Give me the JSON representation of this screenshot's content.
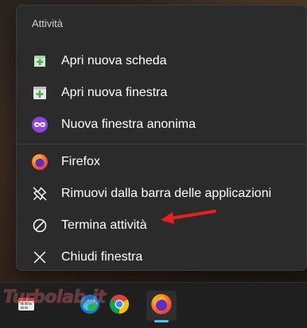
{
  "menu": {
    "header": "Attività",
    "items": [
      {
        "label": "Apri nuova scheda",
        "icon": "new-tab-icon"
      },
      {
        "label": "Apri nuova finestra",
        "icon": "new-window-icon"
      },
      {
        "label": "Nuova finestra anonima",
        "icon": "private-window-icon"
      },
      {
        "label": "Firefox",
        "icon": "firefox-icon"
      },
      {
        "label": "Rimuovi dalla barra delle applicazioni",
        "icon": "unpin-icon"
      },
      {
        "label": "Termina attività",
        "icon": "end-task-icon"
      },
      {
        "label": "Chiudi finestra",
        "icon": "close-icon"
      }
    ]
  },
  "annotation": {
    "arrow_color": "#e8201c",
    "points_to": "Termina attività"
  },
  "taskbar": {
    "apps": [
      {
        "name": "app-icon",
        "icon": "grid-app-icon"
      },
      {
        "name": "edge",
        "icon": "browser-icon"
      },
      {
        "name": "chrome",
        "icon": "chrome-icon"
      },
      {
        "name": "firefox",
        "icon": "firefox-icon",
        "active": true
      }
    ],
    "indicator_color": "#4cc2ff"
  },
  "watermark": "Turbolab.it",
  "colors": {
    "menu_bg": "#2b2b2b",
    "text": "#ffffff",
    "header_text": "#d0d0d0",
    "accent_green": "#3fae49",
    "private_purple": "#8f44d8"
  }
}
